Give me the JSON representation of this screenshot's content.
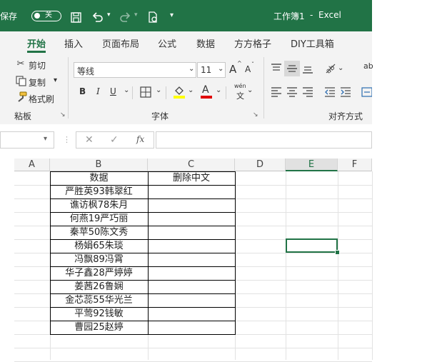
{
  "titlebar": {
    "autosave_label": "保存",
    "toggle_label": "关",
    "doc_title": "工作簿1",
    "separator": "-",
    "app_name": "Excel"
  },
  "tabs": [
    "开始",
    "插入",
    "页面布局",
    "公式",
    "数据",
    "方方格子",
    "DIY工具箱"
  ],
  "clipboard": {
    "cut": "剪切",
    "copy": "复制",
    "format_painter": "格式刷",
    "group_label": "粘板"
  },
  "font": {
    "name": "等线",
    "size": "11",
    "grow": "A",
    "shrink": "A",
    "bold": "B",
    "italic": "I",
    "underline": "U",
    "color_letter": "A",
    "group_label": "字体",
    "wen_top": "wén",
    "wen_bottom": "文"
  },
  "alignment": {
    "group_label": "对齐方式",
    "wrap_partial": "ab"
  },
  "formula_bar": {
    "fx": "fx",
    "cancel": "✕",
    "confirm": "✓"
  },
  "columns": [
    "A",
    "B",
    "C",
    "D",
    "E",
    "F"
  ],
  "selected_column": "E",
  "table": {
    "headers": [
      "数据",
      "删除中文"
    ],
    "rows": [
      "严胜英93韩翠红",
      "谯访枫78朱月",
      "何燕19严巧丽",
      "秦苹50陈文秀",
      "杨娟65朱琰",
      "冯飘89冯霄",
      "华子鑫28严婷婷",
      "姜茜26鲁娴",
      "金芯蕊55华光兰",
      "平莺92钱敏",
      "曹园25赵婷"
    ]
  },
  "colors": {
    "accent": "#217346",
    "font_color_bar": "#e00000",
    "highlight_bar": "#ffff00"
  }
}
